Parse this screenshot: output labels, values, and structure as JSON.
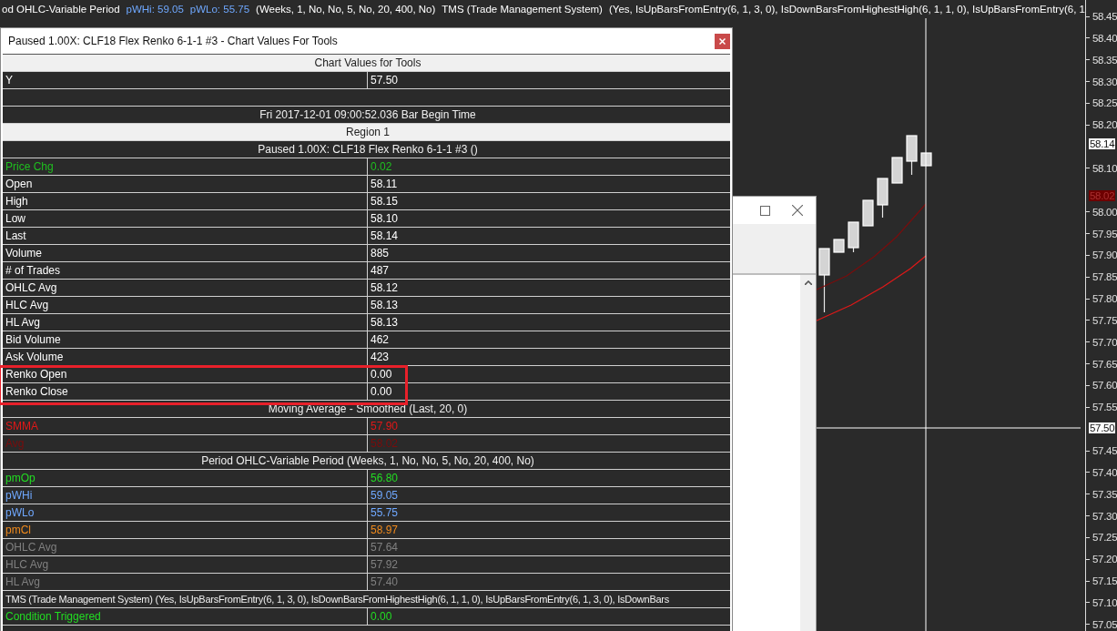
{
  "header_bar": {
    "segments": [
      {
        "text": "od OHLC-Variable Period",
        "color": "#ffffff"
      },
      {
        "text": "pWHi: 59.05",
        "color": "#6fa8ff"
      },
      {
        "text": "pWLo: 55.75",
        "color": "#6fa8ff"
      },
      {
        "text": "(Weeks, 1, No, No, 5, No, 20, 400, No)",
        "color": "#ffffff"
      },
      {
        "text": "TMS (Trade Management System)",
        "color": "#ffffff"
      },
      {
        "text": "(Yes, IsUpBarsFromEntry(6, 1, 3, 0), IsDownBarsFromHighestHigh(6, 1, 1, 0), IsUpBarsFromEntry(6, 1",
        "color": "#ffffff"
      }
    ]
  },
  "price_axis": {
    "labels": [
      "58.45",
      "58.40",
      "58.35",
      "58.30",
      "58.25",
      "58.20",
      "58.10",
      "58.00",
      "57.95",
      "57.90",
      "57.85",
      "57.80",
      "57.75",
      "57.70",
      "57.65",
      "57.60",
      "57.55",
      "57.45",
      "57.40",
      "57.35",
      "57.30",
      "57.25",
      "57.20",
      "57.15",
      "57.10",
      "57.05"
    ],
    "markers": [
      {
        "text": "58.14",
        "kind": "last"
      },
      {
        "text": "58.02",
        "kind": "average"
      },
      {
        "text": "57.50",
        "kind": "cursor"
      }
    ]
  },
  "dialog": {
    "title": "Paused 1.00X: CLF18  Flex Renko 6-1-1  #3 - Chart Values For Tools",
    "rows": [
      {
        "kind": "header",
        "text": "Chart Values for Tools"
      },
      {
        "kind": "value",
        "label": "Y",
        "value": "57.50"
      },
      {
        "kind": "blank"
      },
      {
        "kind": "section",
        "text": "Fri 2017-12-01  09:00:52.036  Bar Begin Time"
      },
      {
        "kind": "header",
        "text": "Region 1"
      },
      {
        "kind": "section",
        "text": "Paused 1.00X: CLF18  Flex Renko 6-1-1  #3 ()"
      },
      {
        "kind": "value",
        "label": "Price Chg",
        "value": "0.02",
        "color": "#1fbf1f"
      },
      {
        "kind": "value",
        "label": "Open",
        "value": "58.11"
      },
      {
        "kind": "value",
        "label": "High",
        "value": "58.15"
      },
      {
        "kind": "value",
        "label": "Low",
        "value": "58.10"
      },
      {
        "kind": "value",
        "label": "Last",
        "value": "58.14"
      },
      {
        "kind": "value",
        "label": "Volume",
        "value": "885"
      },
      {
        "kind": "value",
        "label": "# of Trades",
        "value": "487"
      },
      {
        "kind": "value",
        "label": "OHLC Avg",
        "value": "58.12"
      },
      {
        "kind": "value",
        "label": "HLC Avg",
        "value": "58.13"
      },
      {
        "kind": "value",
        "label": "HL Avg",
        "value": "58.13"
      },
      {
        "kind": "value",
        "label": "Bid Volume",
        "value": "462"
      },
      {
        "kind": "value",
        "label": "Ask Volume",
        "value": "423"
      },
      {
        "kind": "value",
        "label": "Renko Open",
        "value": "0.00"
      },
      {
        "kind": "value",
        "label": "Renko Close",
        "value": "0.00"
      },
      {
        "kind": "section",
        "text": "Moving Average - Smoothed (Last, 20, 0)"
      },
      {
        "kind": "value",
        "label": "SMMA",
        "value": "57.90",
        "color": "#e01818"
      },
      {
        "kind": "value",
        "label": "Avg",
        "value": "58.02",
        "color": "#7a0c0c"
      },
      {
        "kind": "section",
        "text": "Period OHLC-Variable Period (Weeks, 1, No, No, 5, No, 20, 400, No)"
      },
      {
        "kind": "value",
        "label": "pmOp",
        "value": "56.80",
        "color": "#22dd22"
      },
      {
        "kind": "value",
        "label": "pWHi",
        "value": "59.05",
        "color": "#6fa8ff"
      },
      {
        "kind": "value",
        "label": "pWLo",
        "value": "55.75",
        "color": "#6fa8ff"
      },
      {
        "kind": "value",
        "label": "pmCl",
        "value": "58.97",
        "color": "#f08a1c"
      },
      {
        "kind": "value",
        "label": "OHLC Avg",
        "value": "57.64",
        "color": "#808080"
      },
      {
        "kind": "value",
        "label": "HLC Avg",
        "value": "57.92",
        "color": "#808080"
      },
      {
        "kind": "value",
        "label": "HL Avg",
        "value": "57.40",
        "color": "#808080"
      },
      {
        "kind": "note",
        "text": "TMS (Trade Management System) (Yes, IsUpBarsFromEntry(6, 1, 3, 0), IsDownBarsFromHighestHigh(6, 1, 1, 0), IsUpBarsFromEntry(6, 1, 3, 0), IsDownBars"
      },
      {
        "kind": "value",
        "label": "Condition Triggered",
        "value": "0.00",
        "color": "#22dd22"
      },
      {
        "kind": "blank"
      }
    ]
  }
}
